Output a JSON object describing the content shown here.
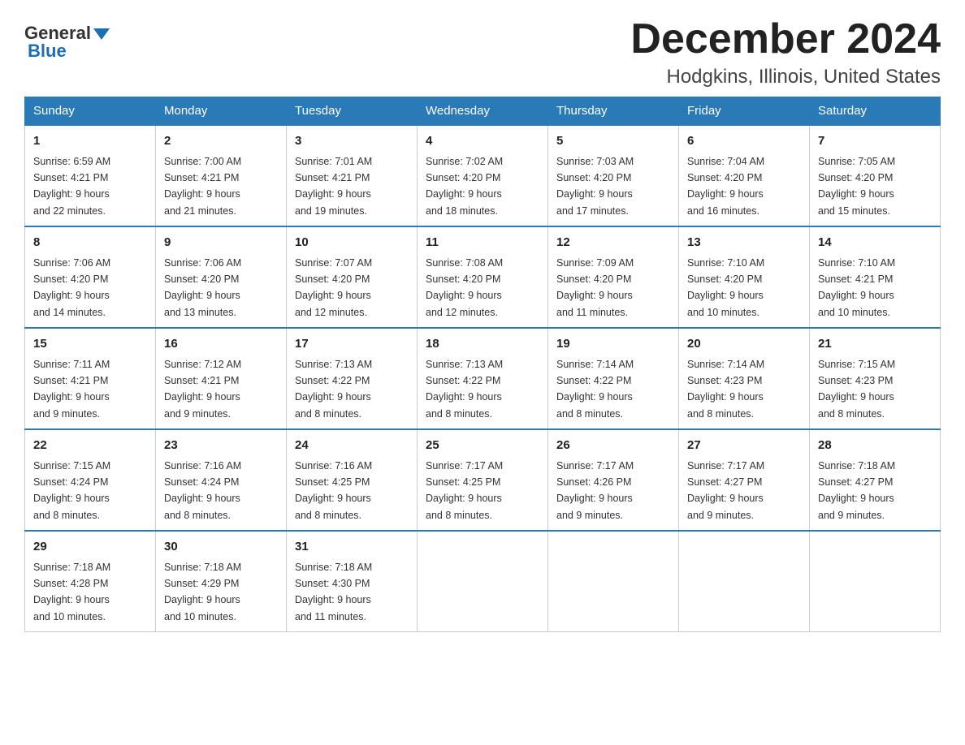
{
  "header": {
    "logo": {
      "general": "General",
      "blue": "Blue"
    },
    "title": "December 2024",
    "subtitle": "Hodgkins, Illinois, United States"
  },
  "weekdays": [
    "Sunday",
    "Monday",
    "Tuesday",
    "Wednesday",
    "Thursday",
    "Friday",
    "Saturday"
  ],
  "weeks": [
    [
      {
        "day": "1",
        "sunrise": "6:59 AM",
        "sunset": "4:21 PM",
        "daylight": "9 hours and 22 minutes."
      },
      {
        "day": "2",
        "sunrise": "7:00 AM",
        "sunset": "4:21 PM",
        "daylight": "9 hours and 21 minutes."
      },
      {
        "day": "3",
        "sunrise": "7:01 AM",
        "sunset": "4:21 PM",
        "daylight": "9 hours and 19 minutes."
      },
      {
        "day": "4",
        "sunrise": "7:02 AM",
        "sunset": "4:20 PM",
        "daylight": "9 hours and 18 minutes."
      },
      {
        "day": "5",
        "sunrise": "7:03 AM",
        "sunset": "4:20 PM",
        "daylight": "9 hours and 17 minutes."
      },
      {
        "day": "6",
        "sunrise": "7:04 AM",
        "sunset": "4:20 PM",
        "daylight": "9 hours and 16 minutes."
      },
      {
        "day": "7",
        "sunrise": "7:05 AM",
        "sunset": "4:20 PM",
        "daylight": "9 hours and 15 minutes."
      }
    ],
    [
      {
        "day": "8",
        "sunrise": "7:06 AM",
        "sunset": "4:20 PM",
        "daylight": "9 hours and 14 minutes."
      },
      {
        "day": "9",
        "sunrise": "7:06 AM",
        "sunset": "4:20 PM",
        "daylight": "9 hours and 13 minutes."
      },
      {
        "day": "10",
        "sunrise": "7:07 AM",
        "sunset": "4:20 PM",
        "daylight": "9 hours and 12 minutes."
      },
      {
        "day": "11",
        "sunrise": "7:08 AM",
        "sunset": "4:20 PM",
        "daylight": "9 hours and 12 minutes."
      },
      {
        "day": "12",
        "sunrise": "7:09 AM",
        "sunset": "4:20 PM",
        "daylight": "9 hours and 11 minutes."
      },
      {
        "day": "13",
        "sunrise": "7:10 AM",
        "sunset": "4:20 PM",
        "daylight": "9 hours and 10 minutes."
      },
      {
        "day": "14",
        "sunrise": "7:10 AM",
        "sunset": "4:21 PM",
        "daylight": "9 hours and 10 minutes."
      }
    ],
    [
      {
        "day": "15",
        "sunrise": "7:11 AM",
        "sunset": "4:21 PM",
        "daylight": "9 hours and 9 minutes."
      },
      {
        "day": "16",
        "sunrise": "7:12 AM",
        "sunset": "4:21 PM",
        "daylight": "9 hours and 9 minutes."
      },
      {
        "day": "17",
        "sunrise": "7:13 AM",
        "sunset": "4:22 PM",
        "daylight": "9 hours and 8 minutes."
      },
      {
        "day": "18",
        "sunrise": "7:13 AM",
        "sunset": "4:22 PM",
        "daylight": "9 hours and 8 minutes."
      },
      {
        "day": "19",
        "sunrise": "7:14 AM",
        "sunset": "4:22 PM",
        "daylight": "9 hours and 8 minutes."
      },
      {
        "day": "20",
        "sunrise": "7:14 AM",
        "sunset": "4:23 PM",
        "daylight": "9 hours and 8 minutes."
      },
      {
        "day": "21",
        "sunrise": "7:15 AM",
        "sunset": "4:23 PM",
        "daylight": "9 hours and 8 minutes."
      }
    ],
    [
      {
        "day": "22",
        "sunrise": "7:15 AM",
        "sunset": "4:24 PM",
        "daylight": "9 hours and 8 minutes."
      },
      {
        "day": "23",
        "sunrise": "7:16 AM",
        "sunset": "4:24 PM",
        "daylight": "9 hours and 8 minutes."
      },
      {
        "day": "24",
        "sunrise": "7:16 AM",
        "sunset": "4:25 PM",
        "daylight": "9 hours and 8 minutes."
      },
      {
        "day": "25",
        "sunrise": "7:17 AM",
        "sunset": "4:25 PM",
        "daylight": "9 hours and 8 minutes."
      },
      {
        "day": "26",
        "sunrise": "7:17 AM",
        "sunset": "4:26 PM",
        "daylight": "9 hours and 9 minutes."
      },
      {
        "day": "27",
        "sunrise": "7:17 AM",
        "sunset": "4:27 PM",
        "daylight": "9 hours and 9 minutes."
      },
      {
        "day": "28",
        "sunrise": "7:18 AM",
        "sunset": "4:27 PM",
        "daylight": "9 hours and 9 minutes."
      }
    ],
    [
      {
        "day": "29",
        "sunrise": "7:18 AM",
        "sunset": "4:28 PM",
        "daylight": "9 hours and 10 minutes."
      },
      {
        "day": "30",
        "sunrise": "7:18 AM",
        "sunset": "4:29 PM",
        "daylight": "9 hours and 10 minutes."
      },
      {
        "day": "31",
        "sunrise": "7:18 AM",
        "sunset": "4:30 PM",
        "daylight": "9 hours and 11 minutes."
      },
      null,
      null,
      null,
      null
    ]
  ],
  "labels": {
    "sunrise": "Sunrise:",
    "sunset": "Sunset:",
    "daylight": "Daylight:"
  }
}
